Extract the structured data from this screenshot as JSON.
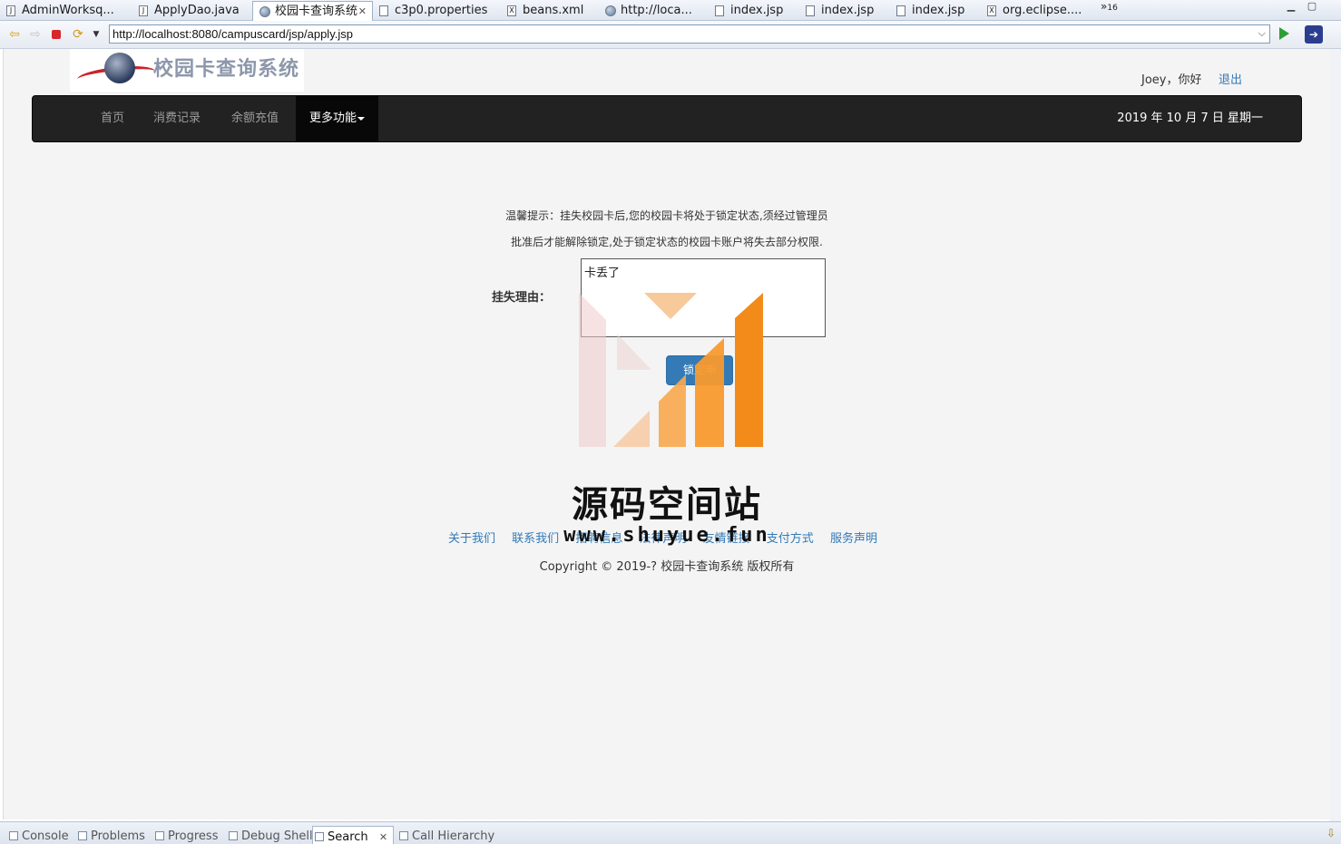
{
  "editor_tabs": [
    {
      "label": "AdminWorksq...",
      "icon": "java-file-icon"
    },
    {
      "label": "ApplyDao.java",
      "icon": "java-file-icon"
    },
    {
      "label": "校园卡查询系统",
      "icon": "globe-icon"
    },
    {
      "label": "c3p0.properties",
      "icon": "properties-file-icon"
    },
    {
      "label": "beans.xml",
      "icon": "xml-file-icon"
    },
    {
      "label": "http://loca...",
      "icon": "globe-icon"
    },
    {
      "label": "index.jsp",
      "icon": "jsp-file-icon"
    },
    {
      "label": "index.jsp",
      "icon": "jsp-file-icon"
    },
    {
      "label": "index.jsp",
      "icon": "jsp-file-icon"
    },
    {
      "label": "org.eclipse....",
      "icon": "xml-file-icon"
    }
  ],
  "overflow": {
    "chevron": "»",
    "count": "16"
  },
  "browser": {
    "url": "http://localhost:8080/campuscard/jsp/apply.jsp"
  },
  "site": {
    "logo_text": "校园卡查询系统",
    "greeting": "Joey，你好",
    "logout": "退出",
    "nav": [
      "首页",
      "消费记录",
      "余额充值",
      "更多功能"
    ],
    "date": "2019 年 10 月 7 日 星期一"
  },
  "form": {
    "notice_line1": "温馨提示：挂失校园卡后,您的校园卡将处于锁定状态,须经过管理员",
    "notice_line2": "批准后才能解除锁定,处于锁定状态的校园卡账户将失去部分权限.",
    "reason_label": "挂失理由：",
    "reason_value": "卡丢了",
    "submit_label": "锁定申"
  },
  "watermark": {
    "title": "源码空间站",
    "url": "www.shuyue.fun"
  },
  "footer": {
    "links": [
      "关于我们",
      "联系我们",
      "招聘信息",
      "法律声明",
      "友情链接",
      "支付方式",
      "服务声明"
    ],
    "copyright": "Copyright © 2019-? 校园卡查询系统 版权所有"
  },
  "bottom_views": [
    {
      "label": "Console",
      "icon": "console-icon"
    },
    {
      "label": "Problems",
      "icon": "problems-icon"
    },
    {
      "label": "Progress",
      "icon": "progress-icon"
    },
    {
      "label": "Debug Shell",
      "icon": "debug-shell-icon"
    },
    {
      "label": "Search",
      "icon": "search-icon",
      "active": true
    },
    {
      "label": "Call Hierarchy",
      "icon": "call-hierarchy-icon"
    }
  ],
  "colors": {
    "accent": "#337ab7",
    "navbar": "#222222",
    "watermark_orange": "#f28b1a"
  }
}
